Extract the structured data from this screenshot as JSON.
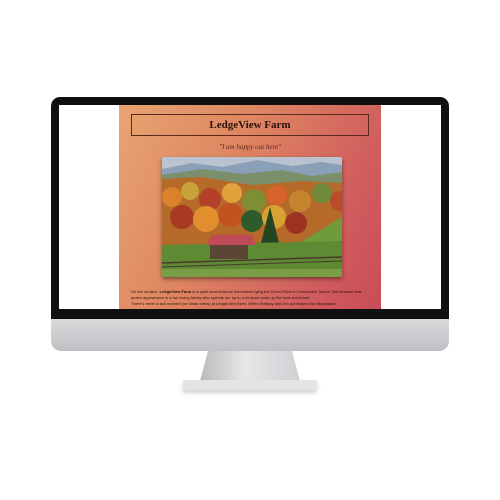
{
  "site": {
    "title": "LedgeView Farm",
    "tagline": "\"I am happy out here\"",
    "intro_lead": "On the surface, ",
    "intro_name": "LedgeView Farm",
    "intro_rest": " is a quiet semi-fictional homestead lying the Green River in Greenwich, Maine. But beneath that quaint appearance is a fun loving family who spends our up to a sit down work up the land and travel.",
    "intro_line2": "There's never a dull moment (or clean dress) at LedgeView Farm. When Brittany and Jim purchased the dilapidated"
  },
  "colors": {
    "gradient_start": "#e7a571",
    "gradient_end": "#c94c58",
    "barn_roof": "#c04a57"
  },
  "photo": {
    "subject": "autumn farm landscape with red barn"
  }
}
